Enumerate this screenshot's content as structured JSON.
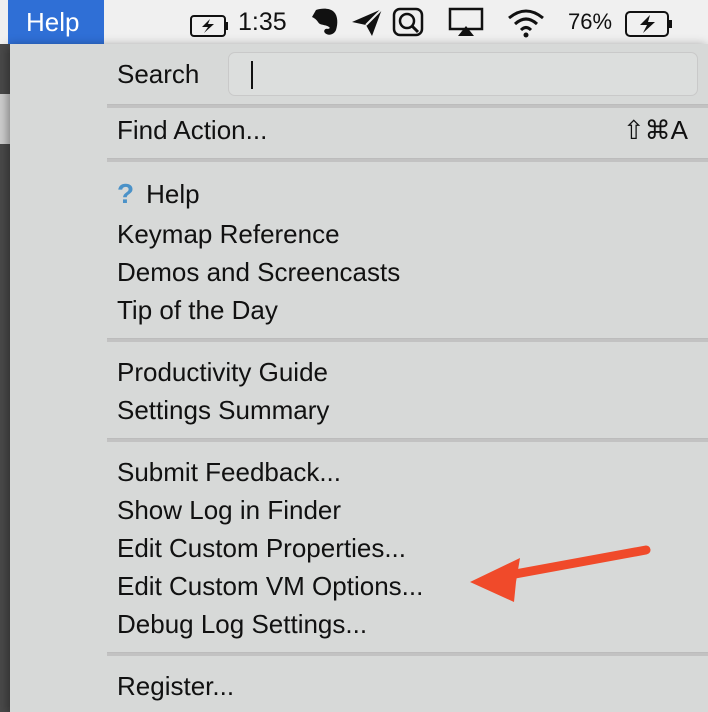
{
  "menubar": {
    "menu_title": "Help",
    "clock": "1:35",
    "battery_percent": "76%"
  },
  "menu": {
    "search": {
      "label": "Search",
      "value": ""
    },
    "find_action": {
      "label": "Find Action...",
      "shortcut": "⇧⌘A"
    },
    "help_group": [
      "Help",
      "Keymap Reference",
      "Demos and Screencasts",
      "Tip of the Day"
    ],
    "productivity_group": [
      "Productivity Guide",
      "Settings Summary"
    ],
    "feedback_group": [
      "Submit Feedback...",
      "Show Log in Finder",
      "Edit Custom Properties...",
      "Edit Custom VM Options...",
      "Debug Log Settings..."
    ],
    "register_group": [
      "Register..."
    ]
  },
  "colors": {
    "highlight": "#2f6fd6",
    "menu_bg": "#d7d9d8",
    "arrow": "#f04a2a",
    "help_icon": "#4b92c8"
  },
  "icons": [
    "battery-charging-icon",
    "evernote-icon",
    "send-icon",
    "search-app-icon",
    "airplay-icon",
    "wifi-icon",
    "battery-icon",
    "question-icon",
    "red-arrow-annotation"
  ]
}
